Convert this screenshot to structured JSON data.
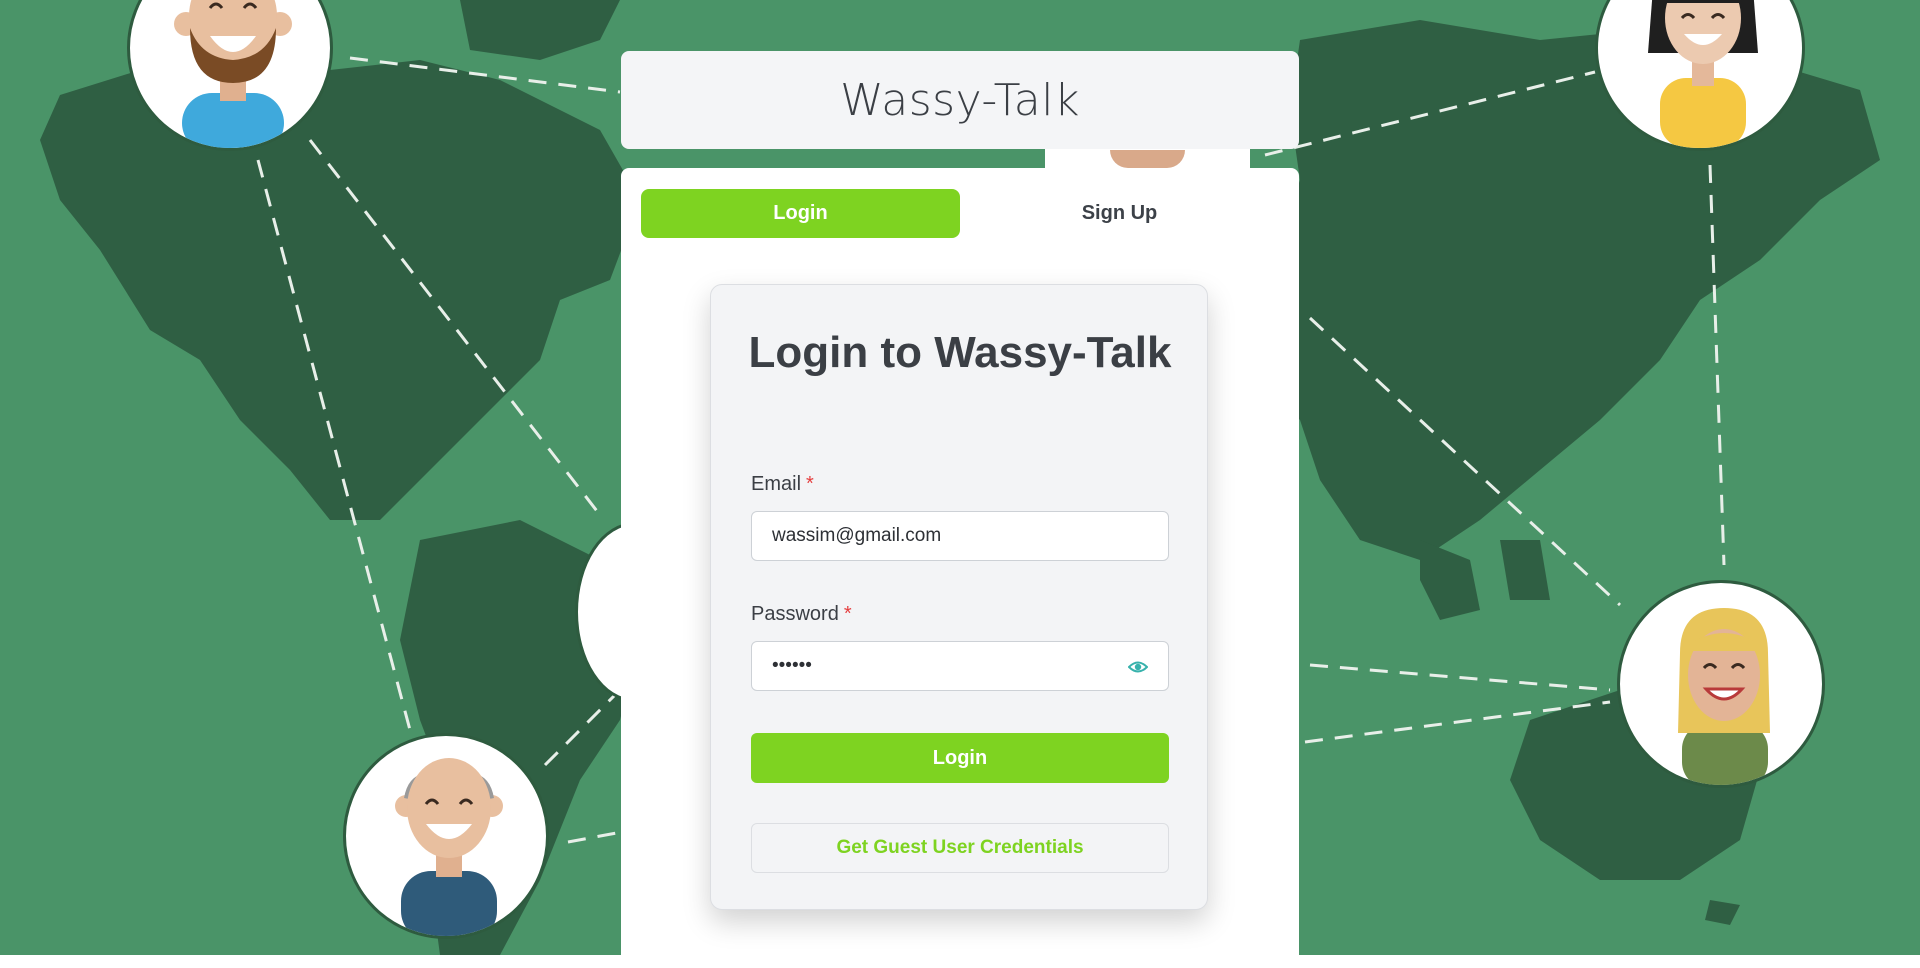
{
  "app": {
    "title": "Wassy-Talk"
  },
  "tabs": [
    {
      "label": "Login",
      "active": true
    },
    {
      "label": "Sign Up",
      "active": false
    }
  ],
  "login_form": {
    "heading": "Login to Wassy-Talk",
    "email": {
      "label": "Email",
      "required_mark": "*",
      "value": "wassim@gmail.com"
    },
    "password": {
      "label": "Password",
      "required_mark": "*",
      "value": "••••••",
      "toggle_icon": "eye-icon"
    },
    "submit_label": "Login",
    "guest_label": "Get Guest User Credentials"
  },
  "colors": {
    "accent": "#7ed321",
    "background": "#4a9468",
    "map": "#2f5f43",
    "required": "#e53e3e",
    "eye": "#38b2ac"
  }
}
